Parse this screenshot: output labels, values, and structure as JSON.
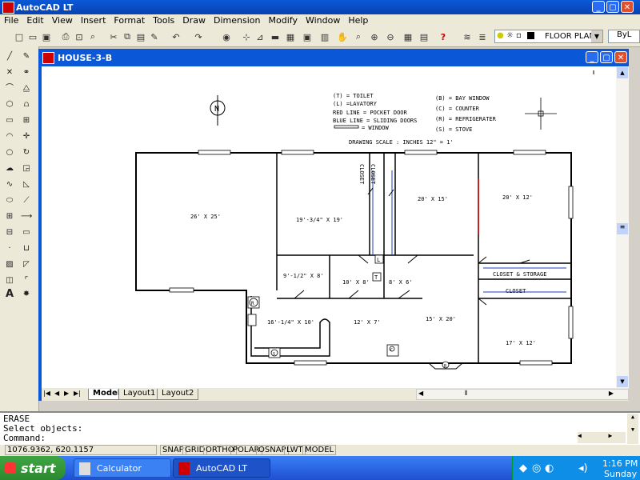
{
  "app": {
    "title": "AutoCAD LT"
  },
  "menu": [
    "File",
    "Edit",
    "View",
    "Insert",
    "Format",
    "Tools",
    "Draw",
    "Dimension",
    "Modify",
    "Window",
    "Help"
  ],
  "toolbar": {
    "layer_name": "FLOOR PLAN",
    "linetype_value": "ByL"
  },
  "document": {
    "title": "HOUSE-3-B"
  },
  "tabs": [
    "Model",
    "Layout1",
    "Layout2"
  ],
  "drawing": {
    "north_label": "N",
    "legend_left": [
      "(T) = TOILET",
      "(L) =LAVATORY",
      "RED LINE = POCKET DOOR",
      "BLUE LINE = SLIDING DOORS",
      "= WINDOW"
    ],
    "legend_right": [
      "(B) = BAY WINDOW",
      "(C) = COUNTER",
      "(R) = REFRIGERATER",
      "(S) = STOVE"
    ],
    "scale_note": "DRAWING SCALE : INCHES   12\" = 1'",
    "rooms": {
      "big": "26' X 25'",
      "r19": "19'-3/4\" X 19'",
      "r20x15": "20' X 15'",
      "r20x12": "20' X 12'",
      "r9": "9'-1/2\" X 8'",
      "r10": "10' X 8'",
      "r8": "8' X 6'",
      "closet_storage": "CLOSET & STORAGE",
      "closet2": "CLOSET",
      "r16": "16'-1/4\" X 10'",
      "r12": "12' X 7'",
      "r15": "15' X 20'",
      "r17": "17' X 12'",
      "closet_v": "CLOSET"
    },
    "markers": {
      "toilet": "T",
      "lavatory": "L",
      "refrigerator": "R",
      "stove": "S",
      "bay": "B",
      "counter": "C"
    }
  },
  "command": {
    "lines": [
      "ERASE",
      "Select objects:",
      "Command:"
    ]
  },
  "status": {
    "coords": "1076.9362, 620.1157",
    "toggles": [
      "SNAP",
      "GRID",
      "ORTHO",
      "POLAR",
      "OSNAP",
      "LWT",
      "MODEL"
    ]
  },
  "taskbar": {
    "start": "start",
    "tasks": [
      "Calculator",
      "AutoCAD LT"
    ],
    "time": "1:16 PM",
    "day": "Sunday"
  }
}
